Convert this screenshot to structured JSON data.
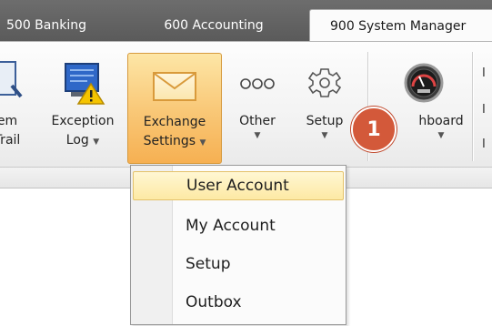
{
  "tabs": [
    {
      "label": "500 Banking"
    },
    {
      "label": "600 Accounting"
    },
    {
      "label": "900 System Manager"
    }
  ],
  "ribbon": {
    "buttons": [
      {
        "line1": "em",
        "line2": "Trail",
        "icon": "audit-trail-icon"
      },
      {
        "line1": "Exception",
        "line2": "Log",
        "icon": "exception-log-icon",
        "dropdown": true
      },
      {
        "line1": "Exchange",
        "line2": "Settings",
        "icon": "envelope-icon",
        "dropdown": true,
        "active": true
      },
      {
        "line1": "Other",
        "line2": "",
        "icon": "ellipsis-icon",
        "dropdown": true
      },
      {
        "line1": "Setup",
        "line2": "",
        "icon": "gear-icon",
        "dropdown": true
      },
      {
        "line1": "hboard",
        "line2": "",
        "icon": "dashboard-gauge-icon",
        "dropdown": true
      }
    ],
    "side_items": [
      "I",
      "I",
      "I"
    ],
    "arrow": "▼"
  },
  "menu": {
    "items": [
      {
        "label": "User Account",
        "highlighted": true
      },
      {
        "label": "My Account"
      },
      {
        "label": "Setup"
      },
      {
        "label": "Outbox"
      }
    ]
  },
  "badge": {
    "number": "1",
    "color": "#d3593a"
  }
}
